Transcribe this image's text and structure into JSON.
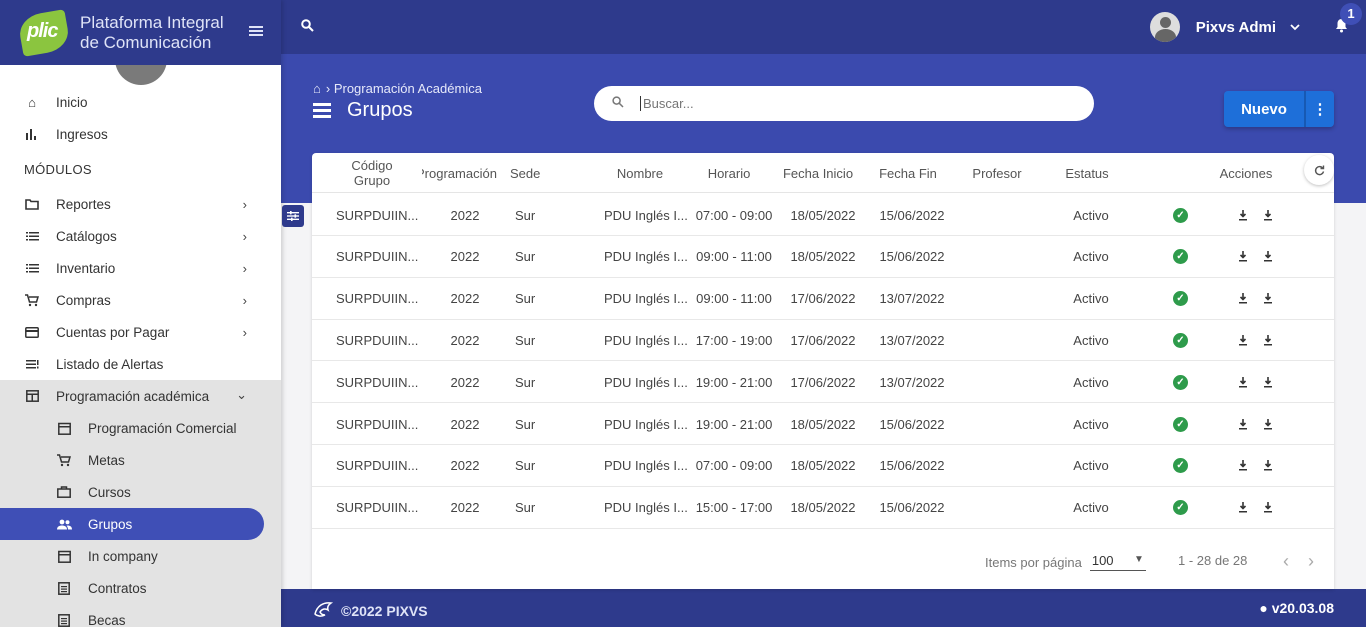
{
  "brand": {
    "logo_text": "plic",
    "title": "Plataforma Integral de Comunicación"
  },
  "topbar": {
    "user_name": "Pixvs Admi",
    "notifications": "1"
  },
  "nav": {
    "top_items": [
      {
        "label": "Inicio",
        "icon": "home-icon"
      },
      {
        "label": "Ingresos",
        "icon": "bar-chart-icon"
      }
    ],
    "section_label": "MÓDULOS",
    "modules": [
      {
        "label": "Reportes",
        "icon": "folder-icon"
      },
      {
        "label": "Catálogos",
        "icon": "list-icon"
      },
      {
        "label": "Inventario",
        "icon": "list-icon"
      },
      {
        "label": "Compras",
        "icon": "cart-icon"
      },
      {
        "label": "Cuentas por Pagar",
        "icon": "card-icon"
      },
      {
        "label": "Listado de Alertas",
        "icon": "alerts-list-icon"
      },
      {
        "label": "Programación académica",
        "icon": "calendar-grid-icon"
      }
    ],
    "submenu": [
      {
        "label": "Programación Comercial",
        "icon": "calendar-icon"
      },
      {
        "label": "Metas",
        "icon": "cart-icon"
      },
      {
        "label": "Cursos",
        "icon": "briefcase-icon"
      },
      {
        "label": "Grupos",
        "icon": "people-icon"
      },
      {
        "label": "In company",
        "icon": "calendar-icon"
      },
      {
        "label": "Contratos",
        "icon": "document-icon"
      },
      {
        "label": "Becas",
        "icon": "document-icon"
      }
    ]
  },
  "header": {
    "breadcrumb": "Programación Académica",
    "title": "Grupos",
    "search_placeholder": "Buscar...",
    "new_button": "Nuevo"
  },
  "table": {
    "columns": [
      "Código Grupo",
      "Programación",
      "Sede",
      "Nombre",
      "Horario",
      "Fecha Inicio",
      "Fecha Fin",
      "Profesor",
      "Estatus",
      "Acciones"
    ],
    "rows": [
      {
        "codigo": "SURPDUIIN...",
        "programacion": "2022",
        "sede": "Sur",
        "nombre": "PDU Inglés I...",
        "horario": "07:00 - 09:00",
        "inicio": "18/05/2022",
        "fin": "15/06/2022",
        "profesor": "",
        "estatus": "Activo"
      },
      {
        "codigo": "SURPDUIIN...",
        "programacion": "2022",
        "sede": "Sur",
        "nombre": "PDU Inglés I...",
        "horario": "09:00 - 11:00",
        "inicio": "18/05/2022",
        "fin": "15/06/2022",
        "profesor": "",
        "estatus": "Activo"
      },
      {
        "codigo": "SURPDUIIN...",
        "programacion": "2022",
        "sede": "Sur",
        "nombre": "PDU Inglés I...",
        "horario": "09:00 - 11:00",
        "inicio": "17/06/2022",
        "fin": "13/07/2022",
        "profesor": "",
        "estatus": "Activo"
      },
      {
        "codigo": "SURPDUIIN...",
        "programacion": "2022",
        "sede": "Sur",
        "nombre": "PDU Inglés I...",
        "horario": "17:00 - 19:00",
        "inicio": "17/06/2022",
        "fin": "13/07/2022",
        "profesor": "",
        "estatus": "Activo"
      },
      {
        "codigo": "SURPDUIIN...",
        "programacion": "2022",
        "sede": "Sur",
        "nombre": "PDU Inglés I...",
        "horario": "19:00 - 21:00",
        "inicio": "17/06/2022",
        "fin": "13/07/2022",
        "profesor": "",
        "estatus": "Activo"
      },
      {
        "codigo": "SURPDUIIN...",
        "programacion": "2022",
        "sede": "Sur",
        "nombre": "PDU Inglés I...",
        "horario": "19:00 - 21:00",
        "inicio": "18/05/2022",
        "fin": "15/06/2022",
        "profesor": "",
        "estatus": "Activo"
      },
      {
        "codigo": "SURPDUIIN...",
        "programacion": "2022",
        "sede": "Sur",
        "nombre": "PDU Inglés I...",
        "horario": "07:00 - 09:00",
        "inicio": "18/05/2022",
        "fin": "15/06/2022",
        "profesor": "",
        "estatus": "Activo"
      },
      {
        "codigo": "SURPDUIIN...",
        "programacion": "2022",
        "sede": "Sur",
        "nombre": "PDU Inglés I...",
        "horario": "15:00 - 17:00",
        "inicio": "18/05/2022",
        "fin": "15/06/2022",
        "profesor": "",
        "estatus": "Activo"
      }
    ]
  },
  "pagination": {
    "items_label": "Items por página",
    "items_value": "100",
    "range": "1 - 28 de 28"
  },
  "footer": {
    "copyright": "©2022 PIXVS",
    "version": "v20.03.08"
  },
  "colors": {
    "primary_dark": "#2e3a8c",
    "primary": "#3b4aae",
    "accent_button": "#1e6fd9",
    "status_ok": "#2e9b4b"
  }
}
